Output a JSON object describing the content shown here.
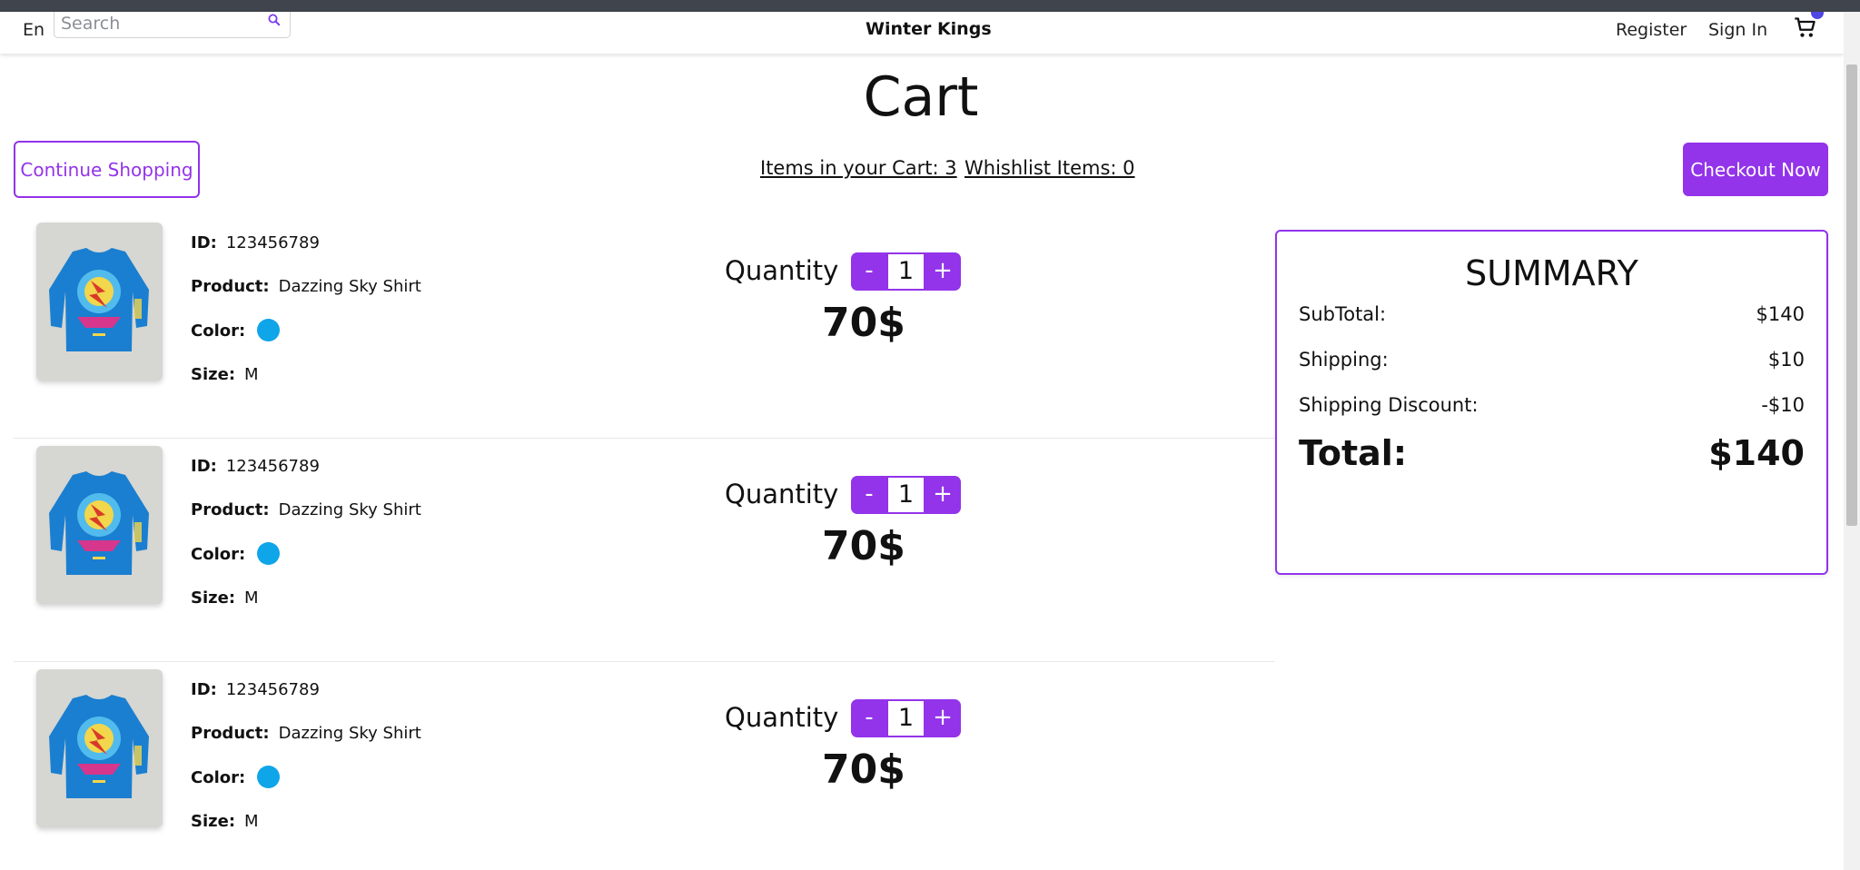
{
  "header": {
    "language": "En",
    "search_placeholder": "Search",
    "brand": "Winter Kings",
    "register": "Register",
    "sign_in": "Sign In"
  },
  "page": {
    "title": "Cart",
    "continue_label": "Continue Shopping",
    "checkout_label": "Checkout Now",
    "cart_count": "Items in your Cart: 3",
    "wishlist_count": "Whishlist Items: 0"
  },
  "labels": {
    "id": "ID:",
    "product": "Product:",
    "color": "Color:",
    "size": "Size:",
    "quantity": "Quantity",
    "minus": "-",
    "plus": "+"
  },
  "items": [
    {
      "id": "123456789",
      "product": "Dazzing Sky Shirt",
      "color": "#0ea5e9",
      "size": "M",
      "quantity": "1",
      "price": "70$"
    },
    {
      "id": "123456789",
      "product": "Dazzing Sky Shirt",
      "color": "#0ea5e9",
      "size": "M",
      "quantity": "1",
      "price": "70$"
    },
    {
      "id": "123456789",
      "product": "Dazzing Sky Shirt",
      "color": "#0ea5e9",
      "size": "M",
      "quantity": "1",
      "price": "70$"
    }
  ],
  "summary": {
    "title": "SUMMARY",
    "subtotal_label": "SubTotal:",
    "subtotal": "$140",
    "shipping_label": "Shipping:",
    "shipping": "$10",
    "discount_label": "Shipping Discount:",
    "discount": "-$10",
    "total_label": "Total:",
    "total": "$140"
  },
  "colors": {
    "accent": "#9333ea",
    "swatch": "#0ea5e9"
  },
  "icons": {
    "search": "search-icon",
    "cart": "shopping-cart-icon"
  }
}
